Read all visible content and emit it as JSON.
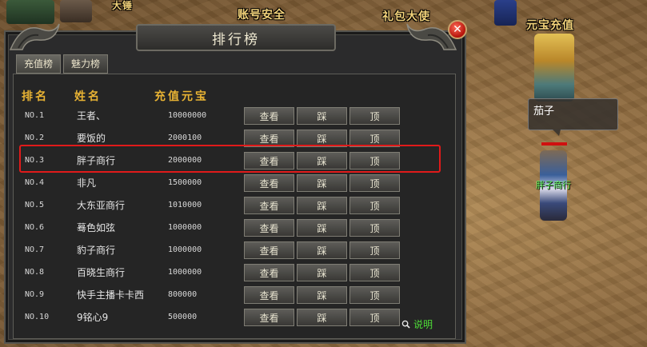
{
  "world": {
    "npc_top_left": "大锤",
    "npc_account": "账号安全",
    "npc_gift": "礼包大使",
    "npc_recharge": "元宝充值",
    "speech_text": "茄子",
    "player_name": "胖子商行"
  },
  "window": {
    "title": "排行榜",
    "close_symbol": "✕",
    "tabs": [
      {
        "label": "充值榜",
        "active": true
      },
      {
        "label": "魅力榜",
        "active": false
      }
    ],
    "headers": {
      "rank": "排名",
      "name": "姓名",
      "value": "充值元宝"
    },
    "buttons": {
      "view": "查看",
      "step": "踩",
      "top": "顶"
    },
    "help_label": "说明",
    "rows": [
      {
        "rank": "NO.1",
        "name": "王者、",
        "value": "10000000"
      },
      {
        "rank": "NO.2",
        "name": "要饭的",
        "value": "2000100"
      },
      {
        "rank": "NO.3",
        "name": "胖子商行",
        "value": "2000000"
      },
      {
        "rank": "NO.4",
        "name": "非凡",
        "value": "1500000"
      },
      {
        "rank": "NO.5",
        "name": "大东亚商行",
        "value": "1010000"
      },
      {
        "rank": "NO.6",
        "name": "蓦色如弦",
        "value": "1000000"
      },
      {
        "rank": "NO.7",
        "name": "豹子商行",
        "value": "1000000"
      },
      {
        "rank": "NO.8",
        "name": "百晓生商行",
        "value": "1000000"
      },
      {
        "rank": "NO.9",
        "name": "快手主播卡卡西",
        "value": "800000"
      },
      {
        "rank": "NO.10",
        "name": "9铭心9",
        "value": "500000"
      }
    ],
    "highlighted_row_index": 2
  },
  "colors": {
    "header_gold": "#e8b334",
    "highlight_red": "#e01a1a",
    "help_green": "#4ede37",
    "player_name_green": "#5ef05a"
  }
}
